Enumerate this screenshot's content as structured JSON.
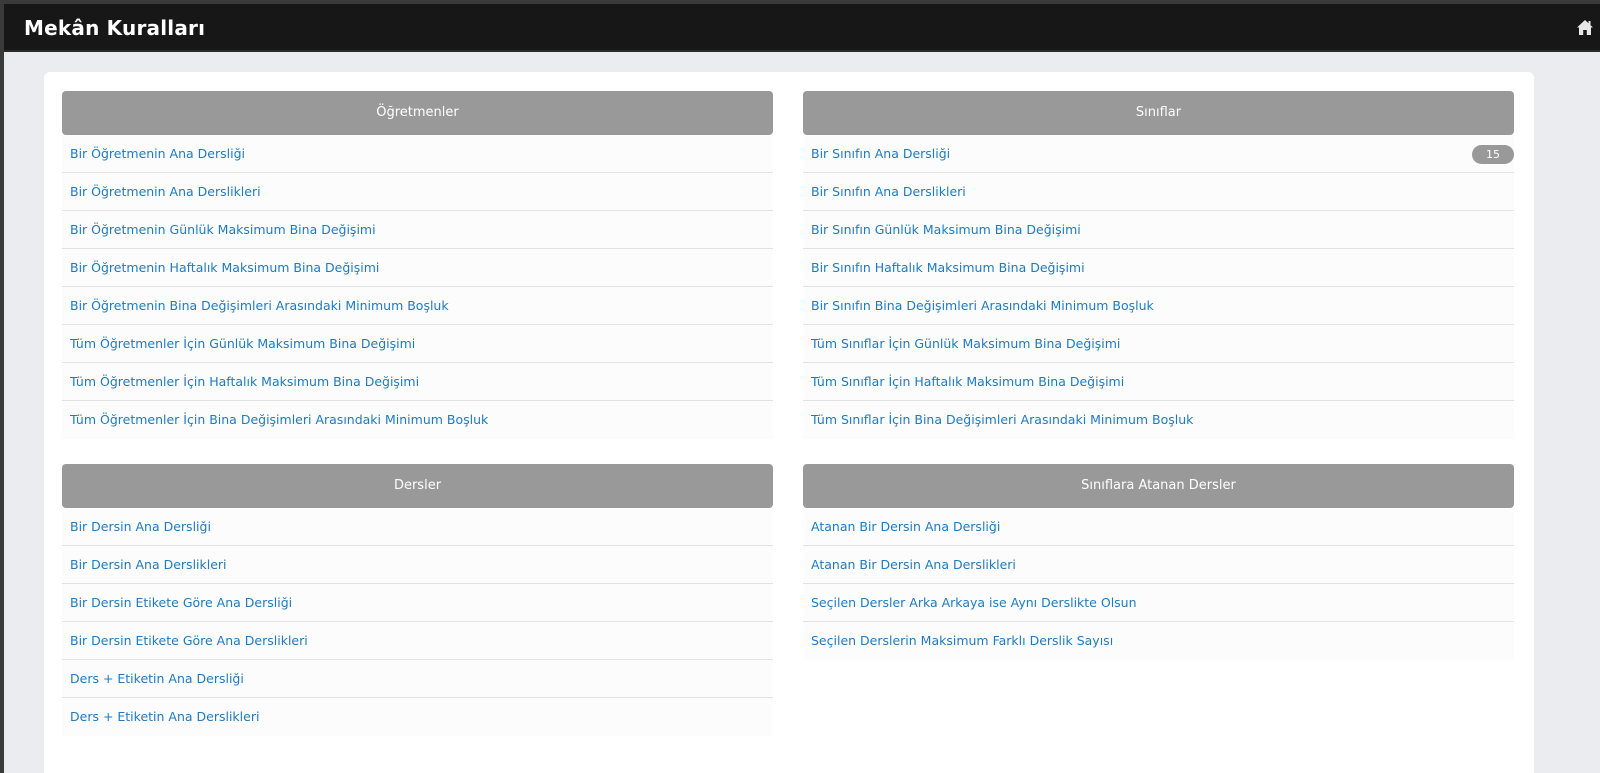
{
  "header": {
    "title": "Mekân Kuralları",
    "home_icon": "home-icon"
  },
  "panels": [
    {
      "title": "Öğretmenler",
      "items": [
        {
          "label": "Bir Öğretmenin Ana Dersliği"
        },
        {
          "label": "Bir Öğretmenin Ana Derslikleri"
        },
        {
          "label": "Bir Öğretmenin Günlük Maksimum Bina Değişimi"
        },
        {
          "label": "Bir Öğretmenin Haftalık Maksimum Bina Değişimi"
        },
        {
          "label": "Bir Öğretmenin Bina Değişimleri Arasındaki Minimum Boşluk"
        },
        {
          "label": "Tüm Öğretmenler İçin Günlük Maksimum Bina Değişimi"
        },
        {
          "label": "Tüm Öğretmenler İçin Haftalık Maksimum Bina Değişimi"
        },
        {
          "label": "Tüm Öğretmenler İçin Bina Değişimleri Arasındaki Minimum Boşluk"
        }
      ]
    },
    {
      "title": "Sınıflar",
      "items": [
        {
          "label": "Bir Sınıfın Ana Dersliği",
          "badge": "15"
        },
        {
          "label": "Bir Sınıfın Ana Derslikleri"
        },
        {
          "label": "Bir Sınıfın Günlük Maksimum Bina Değişimi"
        },
        {
          "label": "Bir Sınıfın Haftalık Maksimum Bina Değişimi"
        },
        {
          "label": "Bir Sınıfın Bina Değişimleri Arasındaki Minimum Boşluk"
        },
        {
          "label": "Tüm Sınıflar İçin Günlük Maksimum Bina Değişimi"
        },
        {
          "label": "Tüm Sınıflar İçin Haftalık Maksimum Bina Değişimi"
        },
        {
          "label": "Tüm Sınıflar İçin Bina Değişimleri Arasındaki Minimum Boşluk"
        }
      ]
    },
    {
      "title": "Dersler",
      "items": [
        {
          "label": "Bir Dersin Ana Dersliği"
        },
        {
          "label": "Bir Dersin Ana Derslikleri"
        },
        {
          "label": "Bir Dersin Etikete Göre Ana Dersliği"
        },
        {
          "label": "Bir Dersin Etikete Göre Ana Derslikleri"
        },
        {
          "label": "Ders + Etiketin Ana Dersliği"
        },
        {
          "label": "Ders + Etiketin Ana Derslikleri"
        }
      ]
    },
    {
      "title": "Sınıflara Atanan Dersler",
      "items": [
        {
          "label": "Atanan Bir Dersin Ana Dersliği"
        },
        {
          "label": "Atanan Bir Dersin Ana Derslikleri"
        },
        {
          "label": "Seçilen Dersler Arka Arkaya ise Aynı Derslikte Olsun"
        },
        {
          "label": "Seçilen Derslerin Maksimum Farklı Derslik Sayısı"
        }
      ]
    }
  ]
}
